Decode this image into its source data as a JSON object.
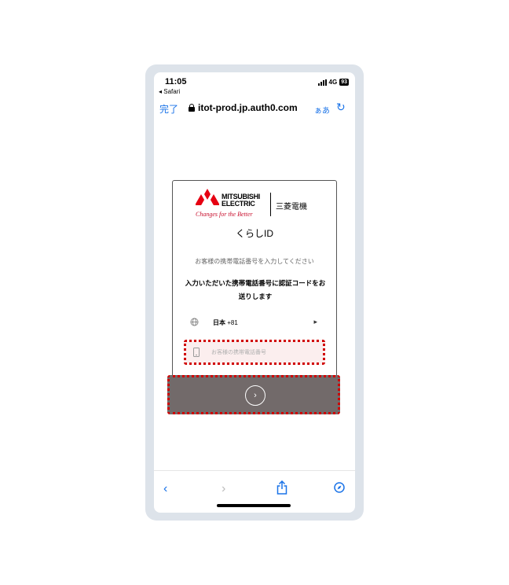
{
  "status_bar": {
    "time": "11:05",
    "back_app": "◂ Safari",
    "network": "4G",
    "battery": "93"
  },
  "browser": {
    "done_label": "完了",
    "url": "itot-prod.jp.auth0.com",
    "text_size_label": "ぁあ",
    "reload_icon": "↻"
  },
  "logo": {
    "brand_line1": "MITSUBISHI",
    "brand_line2": "ELECTRIC",
    "brand_jp": "三菱電機",
    "tagline": "Changes for the Better",
    "brand_color": "#e60012"
  },
  "page": {
    "title": "くらしID",
    "instruction": "お客様の携帯電話番号を入力してください",
    "message": "入力いただいた携帯電話番号に認証コードをお送りします"
  },
  "country": {
    "name": "日本",
    "code": "+81",
    "chevron": "▸"
  },
  "phone_input": {
    "placeholder": "お客様の携帯電話番号",
    "value": ""
  },
  "submit": {
    "icon": "›",
    "color": "#726a6a"
  },
  "toolbar": {
    "back": "‹",
    "forward": "›"
  },
  "colors": {
    "accent": "#1a73e8",
    "highlight": "#d00000"
  }
}
